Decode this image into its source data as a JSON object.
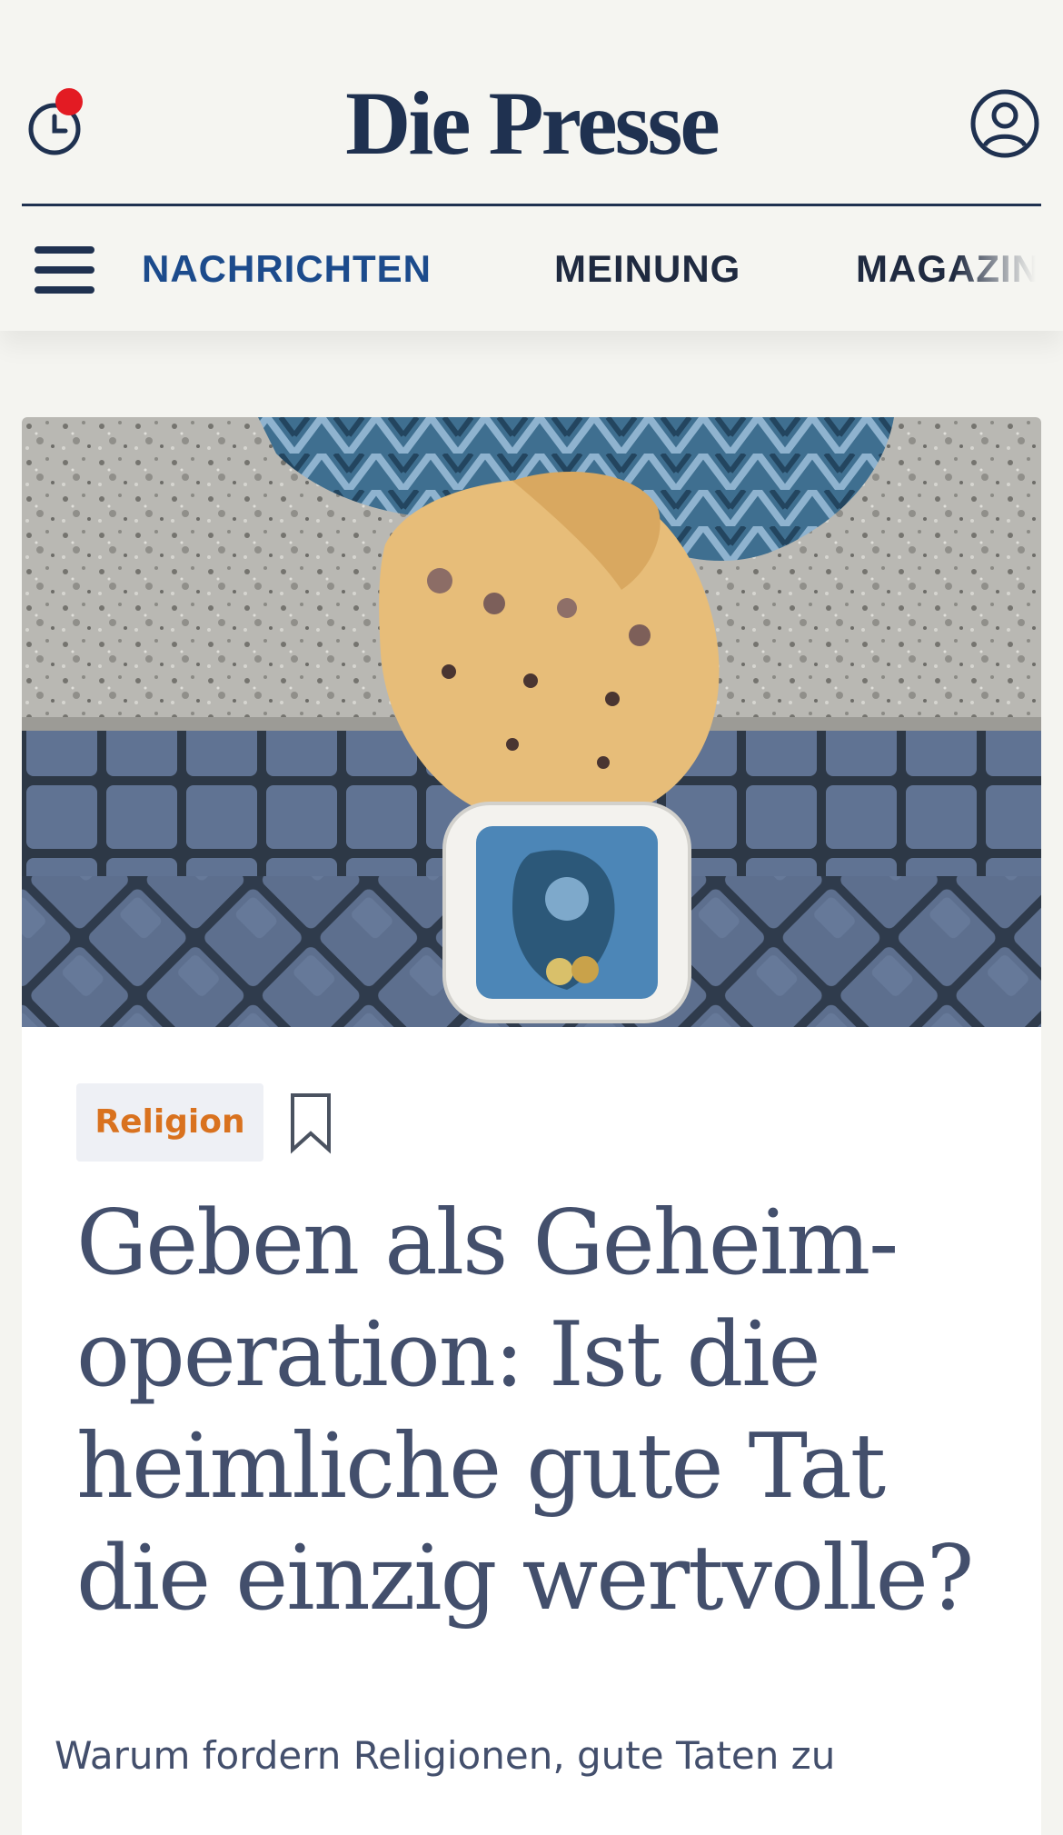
{
  "header": {
    "logo_text": "Die Presse",
    "history_icon": "clock-icon",
    "history_badge_color": "#e31b23",
    "account_icon": "user-circle-icon",
    "brand_color": "#1f3150"
  },
  "nav": {
    "menu_icon": "hamburger-menu-icon",
    "items": [
      {
        "label": "NACHRICHTEN",
        "active": true
      },
      {
        "label": "MEINUNG",
        "active": false
      },
      {
        "label": "MAGAZIN",
        "active": false
      }
    ],
    "active_color": "#1c4b8c"
  },
  "article": {
    "image_alt": "hero-photo",
    "category": "Religion",
    "category_color": "#d9721f",
    "bookmark_icon": "bookmark-icon",
    "headline": "Geben als Geheim-operation: Ist die heimliche gute Tat die einzig wertvolle?",
    "headline_lines": [
      "Geben als Geheim-",
      "operation: Ist die",
      "heimliche gute Tat",
      "die einzig wertvolle?"
    ],
    "teaser": "Warum fordern Religionen, gute Taten zu"
  }
}
